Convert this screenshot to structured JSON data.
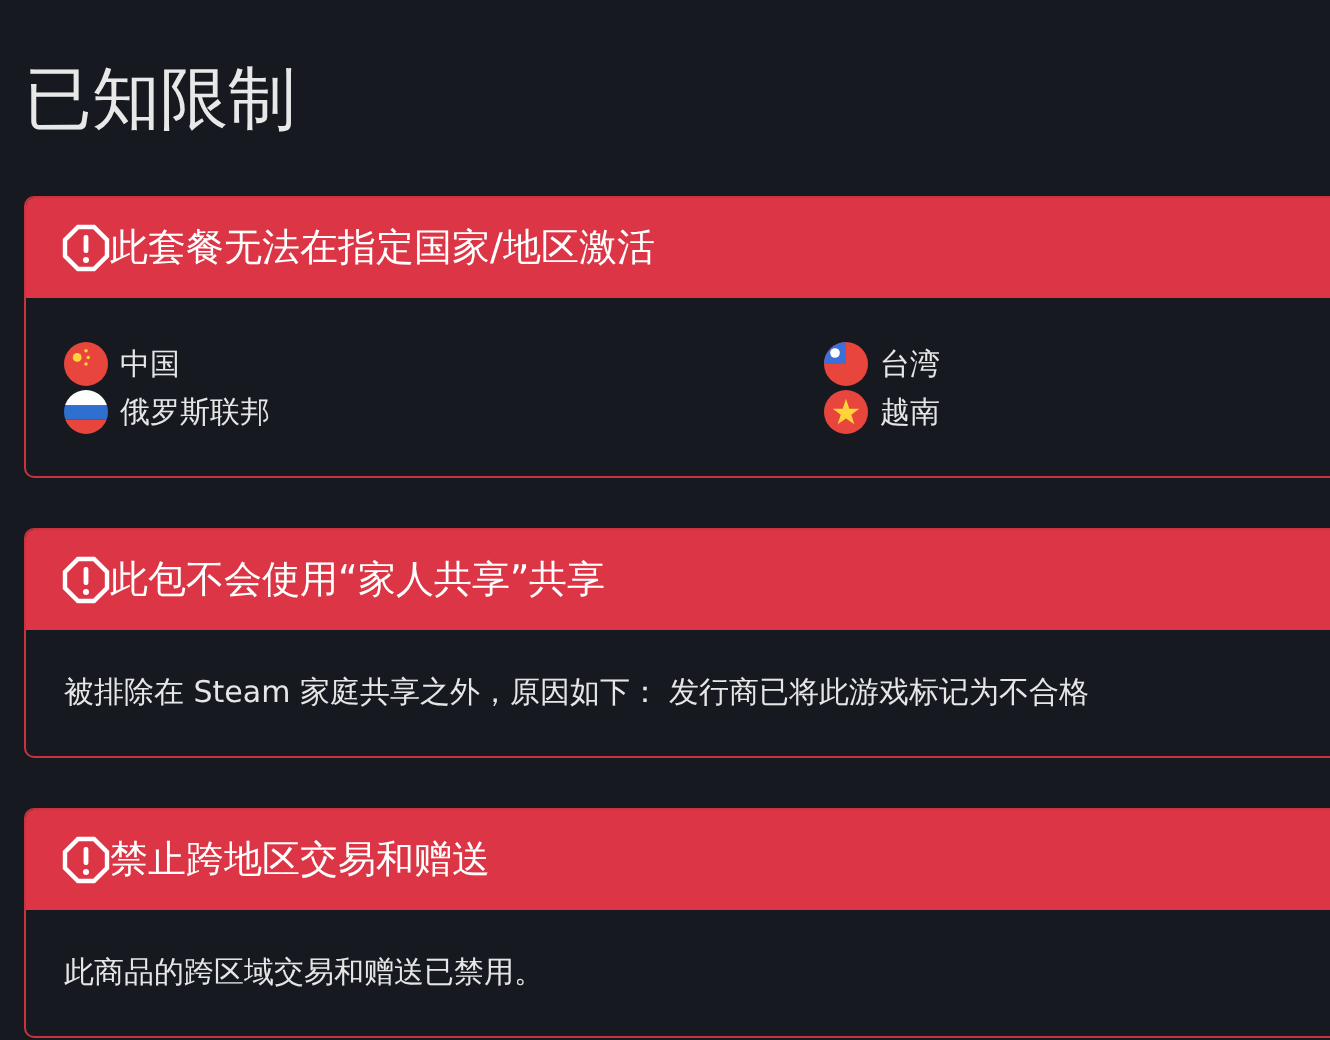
{
  "title": "已知限制",
  "notices": [
    {
      "kind": "countries",
      "heading": "此套餐无法在指定国家/地区激活",
      "countries": [
        {
          "name": "中国",
          "kind": "cn"
        },
        {
          "name": "台湾",
          "kind": "tw"
        },
        {
          "name": "俄罗斯联邦",
          "kind": "ru"
        },
        {
          "name": "越南",
          "kind": "vn"
        }
      ]
    },
    {
      "kind": "text",
      "heading": "此包不会使用“家人共享”共享",
      "text": "被排除在 Steam 家庭共享之外，原因如下：  发行商已将此游戏标记为不合格"
    },
    {
      "kind": "text",
      "heading": "禁止跨地区交易和赠送",
      "text": "此商品的跨区域交易和赠送已禁用。"
    }
  ]
}
